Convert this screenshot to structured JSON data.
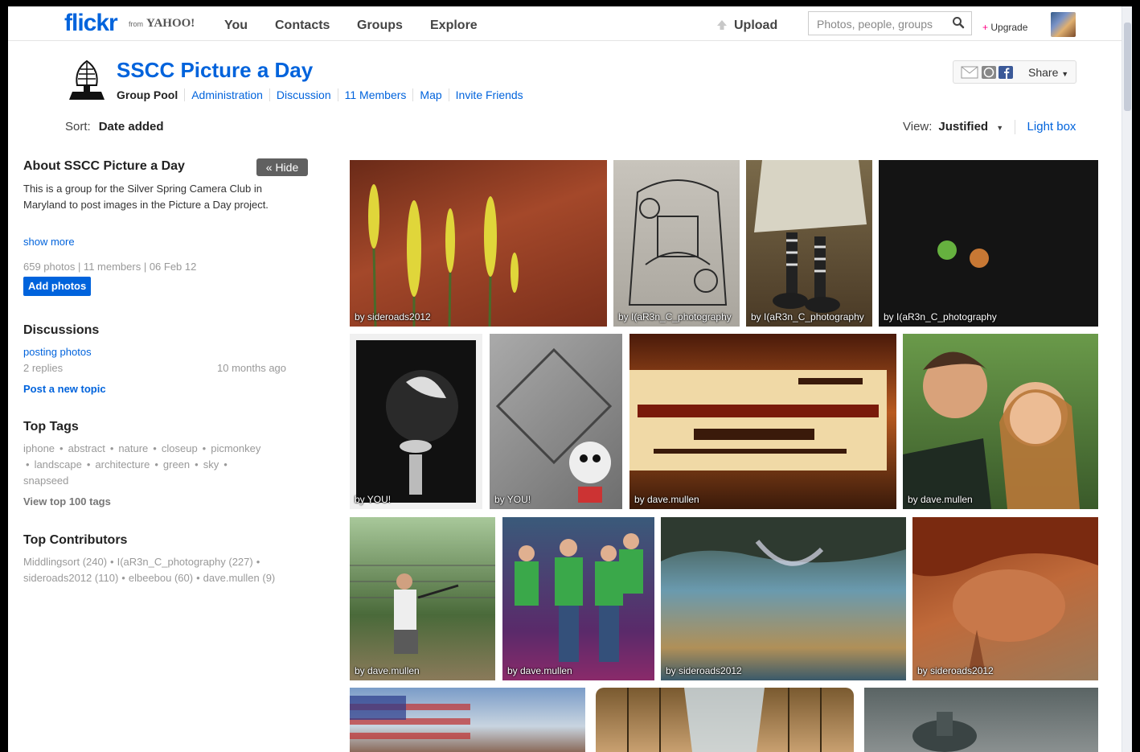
{
  "nav": {
    "logo": "flickr",
    "logo_from": "from",
    "logo_yahoo": "YAHOO!",
    "links": [
      "You",
      "Contacts",
      "Groups",
      "Explore"
    ],
    "upload": "Upload",
    "search_placeholder": "Photos, people, groups",
    "upgrade": "Upgrade"
  },
  "group": {
    "title": "SSCC Picture a Day",
    "tabs": [
      "Group Pool",
      "Administration",
      "Discussion",
      "11 Members",
      "Map",
      "Invite Friends"
    ],
    "share": "Share"
  },
  "sort": {
    "label": "Sort:",
    "value": "Date added"
  },
  "view": {
    "label": "View:",
    "value": "Justified",
    "lightbox": "Light box"
  },
  "sidebar": {
    "about_title": "About SSCC Picture a Day",
    "hide": "« Hide",
    "about_text": "This is a group for the Silver Spring Camera Club in Maryland to post images in the Picture a Day project.",
    "show_more": "show more",
    "stats": "659 photos | 11 members | 06 Feb 12",
    "add_photos": "Add photos",
    "discussions_title": "Discussions",
    "discussion_topic": "posting photos",
    "discussion_replies": "2 replies",
    "discussion_ago": "10 months ago",
    "post_new_topic": "Post a new topic",
    "tags_title": "Top Tags",
    "tags": [
      "iphone",
      "abstract",
      "nature",
      "closeup",
      "picmonkey",
      "landscape",
      "architecture",
      "green",
      "sky",
      "snapseed"
    ],
    "view_top_tags": "View top 100 tags",
    "contributors_title": "Top Contributors",
    "contributors": [
      "Middlingsort (240)",
      "I(aR3n_C_photography (227)",
      "sideroads2012 (110)",
      "elbeebou (60)",
      "dave.mullen (9)"
    ]
  },
  "photos": [
    {
      "caption": "by sideroads2012",
      "bg": "#8a3a22"
    },
    {
      "caption": "by I(aR3n_C_photography",
      "bg": "#b8b5ae"
    },
    {
      "caption": "by I(aR3n_C_photography",
      "bg": "#6b5538"
    },
    {
      "caption": "by I(aR3n_C_photography",
      "bg": "#141414"
    },
    {
      "caption": "by YOU!",
      "bg": "#1c1c1c"
    },
    {
      "caption": "by YOU!",
      "bg": "#8e8e8e"
    },
    {
      "caption": "by dave.mullen",
      "bg": "#7a2c10"
    },
    {
      "caption": "by dave.mullen",
      "bg": "#4f7a3a"
    },
    {
      "caption": "by dave.mullen",
      "bg": "#5a7a4a"
    },
    {
      "caption": "by dave.mullen",
      "bg": "#4a2c5a"
    },
    {
      "caption": "by sideroads2012",
      "bg": "#4b6a7a"
    },
    {
      "caption": "by sideroads2012",
      "bg": "#a45a38"
    },
    {
      "caption": "",
      "bg": "#5b7ca8"
    },
    {
      "caption": "",
      "bg": "#8a6a40"
    },
    {
      "caption": "",
      "bg": "#6a7070"
    }
  ]
}
